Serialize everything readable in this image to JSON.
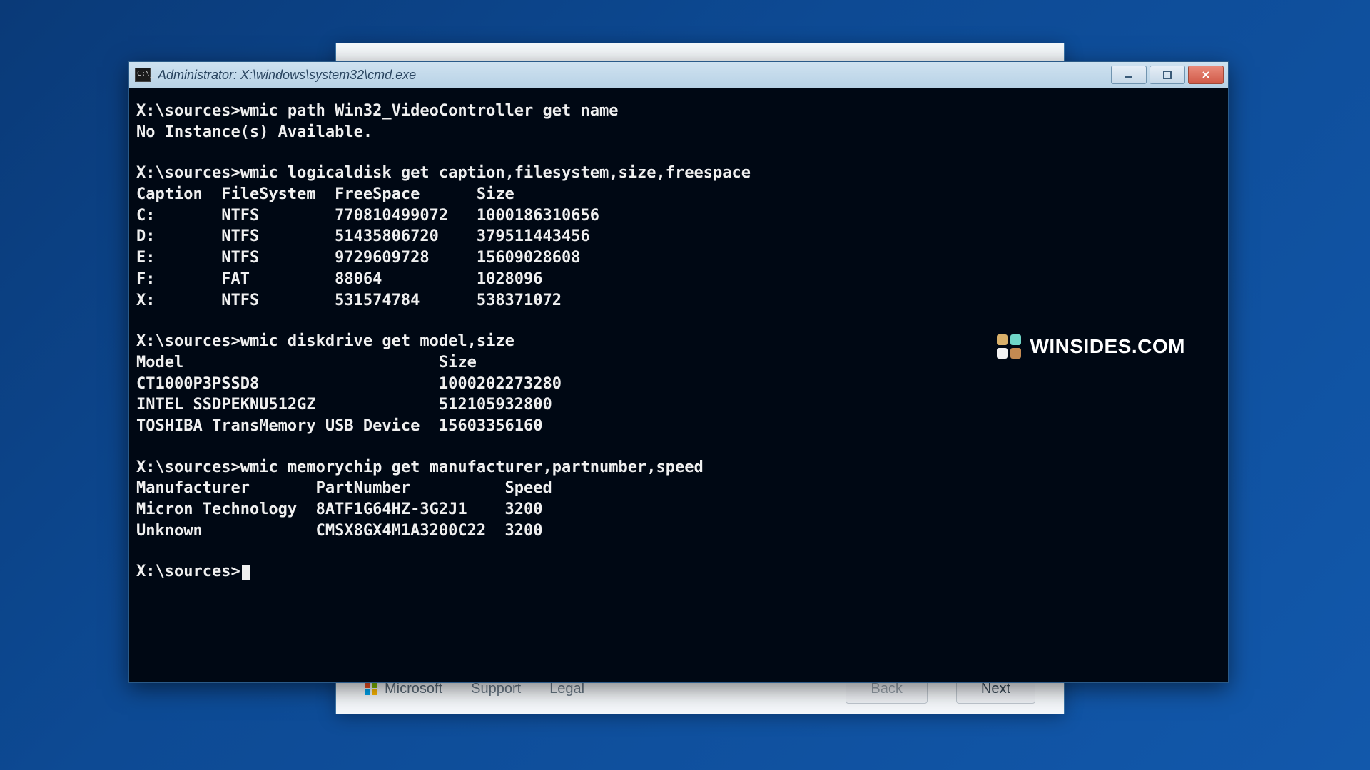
{
  "window": {
    "title": "Administrator: X:\\windows\\system32\\cmd.exe"
  },
  "prompt": "X:\\sources>",
  "commands": {
    "video": {
      "cmd": "wmic path Win32_VideoController get name",
      "output": "No Instance(s) Available."
    },
    "logicaldisk": {
      "cmd": "wmic logicaldisk get caption,filesystem,size,freespace",
      "headers": [
        "Caption",
        "FileSystem",
        "FreeSpace",
        "Size"
      ],
      "rows": [
        {
          "Caption": "C:",
          "FileSystem": "NTFS",
          "FreeSpace": "770810499072",
          "Size": "1000186310656"
        },
        {
          "Caption": "D:",
          "FileSystem": "NTFS",
          "FreeSpace": "51435806720",
          "Size": "379511443456"
        },
        {
          "Caption": "E:",
          "FileSystem": "NTFS",
          "FreeSpace": "9729609728",
          "Size": "15609028608"
        },
        {
          "Caption": "F:",
          "FileSystem": "FAT",
          "FreeSpace": "88064",
          "Size": "1028096"
        },
        {
          "Caption": "X:",
          "FileSystem": "NTFS",
          "FreeSpace": "531574784",
          "Size": "538371072"
        }
      ]
    },
    "diskdrive": {
      "cmd": "wmic diskdrive get model,size",
      "headers": [
        "Model",
        "Size"
      ],
      "rows": [
        {
          "Model": "CT1000P3PSSD8",
          "Size": "1000202273280"
        },
        {
          "Model": "INTEL SSDPEKNU512GZ",
          "Size": "512105932800"
        },
        {
          "Model": "TOSHIBA TransMemory USB Device",
          "Size": "15603356160"
        }
      ]
    },
    "memorychip": {
      "cmd": "wmic memorychip get manufacturer,partnumber,speed",
      "headers": [
        "Manufacturer",
        "PartNumber",
        "Speed"
      ],
      "rows": [
        {
          "Manufacturer": "Micron Technology",
          "PartNumber": "8ATF1G64HZ-3G2J1",
          "Speed": "3200"
        },
        {
          "Manufacturer": "Unknown",
          "PartNumber": "CMSX8GX4M1A3200C22",
          "Speed": "3200"
        }
      ]
    }
  },
  "back_window": {
    "microsoft_label": "Microsoft",
    "support_label": "Support",
    "legal_label": "Legal",
    "back_label": "Back",
    "next_label": "Next"
  },
  "watermark": "WINSIDES.COM"
}
